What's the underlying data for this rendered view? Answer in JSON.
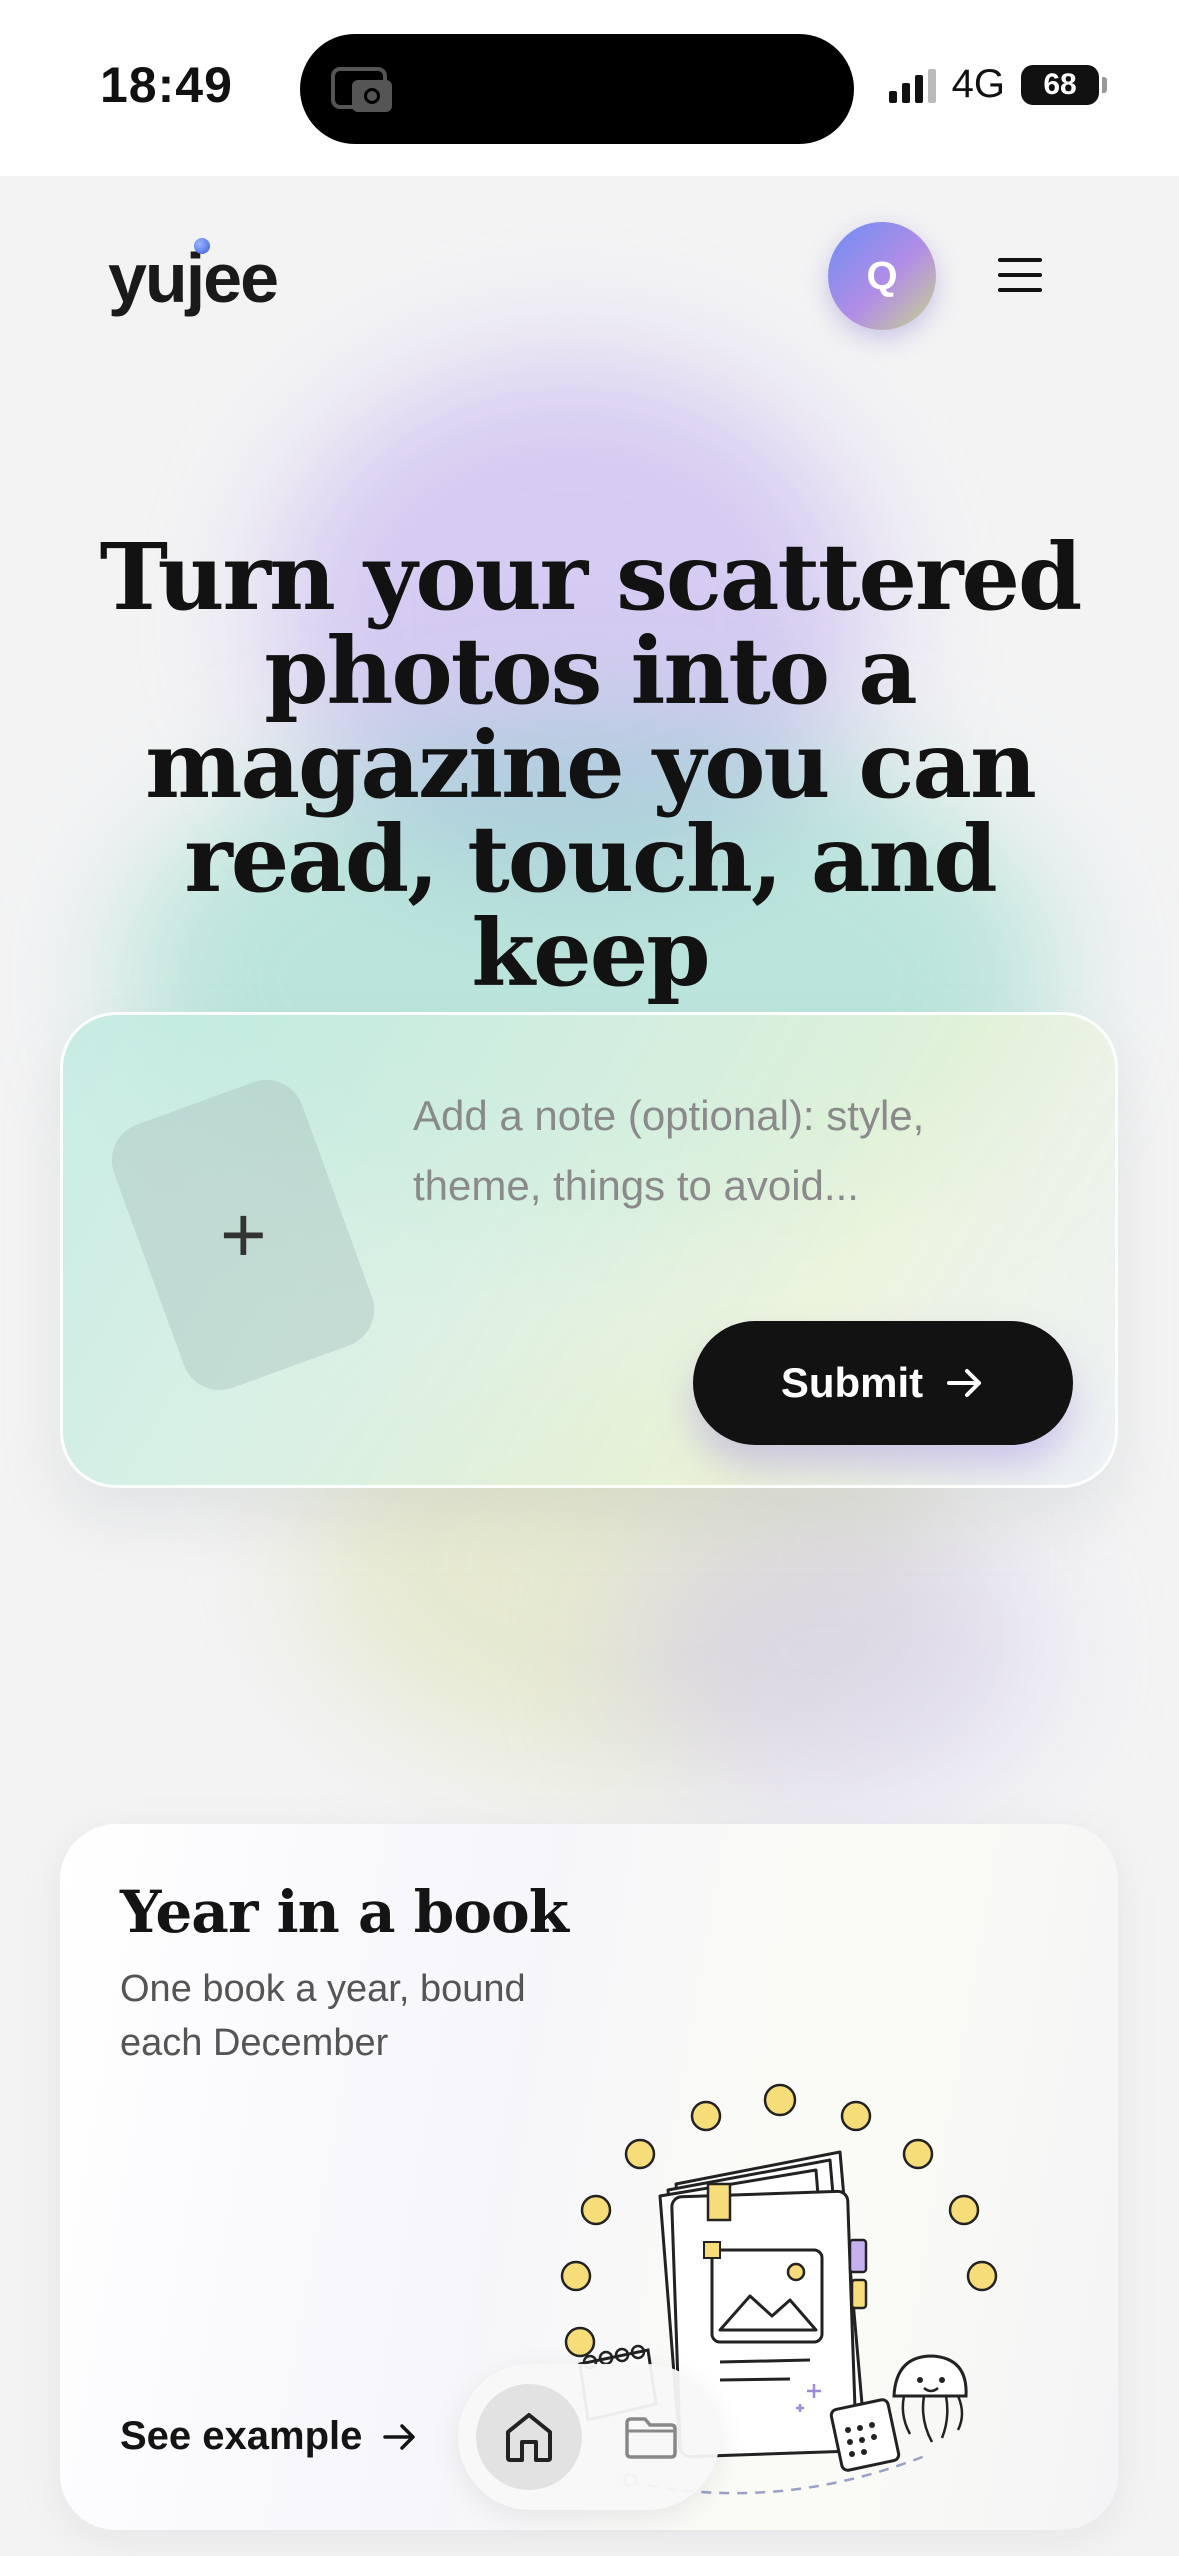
{
  "status_bar": {
    "time": "18:49",
    "network": "4G",
    "battery": "68"
  },
  "header": {
    "logo": "yujee",
    "avatar_initial": "Q"
  },
  "headline": "Turn your scattered photos into a magazine you can read, touch, and keep",
  "upload": {
    "add_symbol": "+",
    "note_placeholder": "Add a note (optional): style, theme, things to avoid...",
    "submit_label": "Submit"
  },
  "year_card": {
    "title": "Year in a book",
    "subtitle": "One book a year, bound each December",
    "link_label": "See example"
  },
  "icons": [
    "camera-icon",
    "menu-icon",
    "plus-icon",
    "arrow-right-icon",
    "home-icon",
    "folder-icon"
  ]
}
